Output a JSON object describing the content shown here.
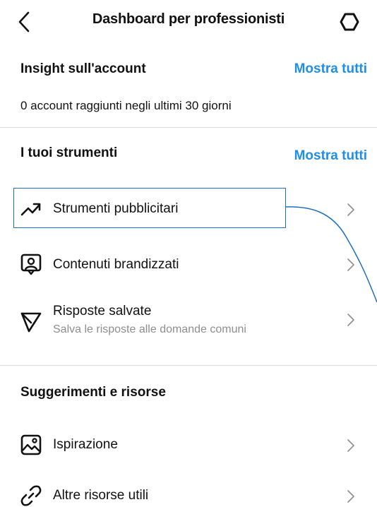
{
  "header": {
    "title": "Dashboard per professionisti",
    "back_icon": "chevron-left-icon",
    "settings_icon": "settings-icon"
  },
  "insights": {
    "heading": "Insight sull'account",
    "show_all": "Mostra tutti",
    "summary": "0 account raggiunti negli ultimi 30 giorni"
  },
  "tools": {
    "heading": "I tuoi strumenti",
    "show_all": "Mostra tutti",
    "items": [
      {
        "label": "Strumenti pubblicitari",
        "icon": "trending-up-icon"
      },
      {
        "label": "Contenuti brandizzati",
        "icon": "branded-content-icon"
      },
      {
        "label": "Risposte salvate",
        "sublabel": "Salva le risposte alle domande comuni",
        "icon": "send-icon"
      }
    ]
  },
  "resources": {
    "heading": "Suggerimenti e risorse",
    "items": [
      {
        "label": "Ispirazione",
        "icon": "image-icon"
      },
      {
        "label": "Altre risorse utili",
        "icon": "link-icon"
      }
    ]
  },
  "colors": {
    "accent": "#1f8ee6",
    "annotation": "#1f6fbf",
    "secondary_text": "#8e8e8e",
    "divider": "#dbdbdb"
  }
}
